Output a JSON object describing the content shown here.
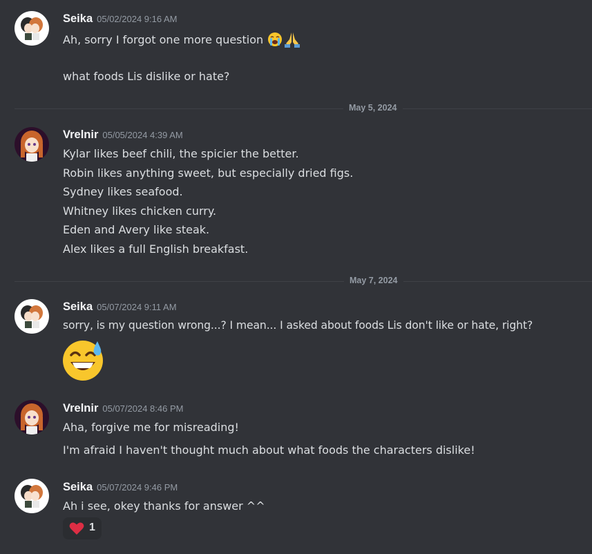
{
  "messages": [
    {
      "author": "Seika",
      "timestamp": "05/02/2024 9:16 AM",
      "lines": [
        "Ah, sorry I forgot one more question",
        "what foods Lis dislike or hate?"
      ],
      "emoji": [
        "loudly-crying-face",
        "folded-hands"
      ]
    },
    {
      "author": "Vrelnir",
      "timestamp": "05/05/2024 4:39 AM",
      "lines": [
        "Kylar likes beef chili, the spicier the better.",
        "Robin likes anything sweet, but especially dried figs.",
        "Sydney likes seafood.",
        "Whitney likes chicken curry.",
        "Eden and Avery like steak.",
        "Alex likes a full English breakfast."
      ]
    },
    {
      "author": "Seika",
      "timestamp": "05/07/2024 9:11 AM",
      "lines": [
        "sorry, is my question wrong...?  I mean... I asked about foods Lis don't like or hate, right?"
      ],
      "emoji": [
        "grinning-face-with-sweat"
      ]
    },
    {
      "author": "Vrelnir",
      "timestamp": "05/07/2024 8:46 PM",
      "lines": [
        "Aha, forgive me for misreading!",
        "I'm afraid I haven't thought much about what foods the characters dislike!"
      ]
    },
    {
      "author": "Seika",
      "timestamp": "05/07/2024 9:46 PM",
      "lines": [
        "Ah i see, okey thanks for answer ^^"
      ],
      "reaction": {
        "emoji": "red-heart",
        "count": "1"
      }
    }
  ],
  "dividers": [
    "May 5, 2024",
    "May 7, 2024"
  ],
  "colors": {
    "background": "#313338",
    "text": "#dbdee1",
    "username": "#f2f3f5",
    "muted": "#949ba4",
    "reaction_bg": "#2b2d31"
  }
}
